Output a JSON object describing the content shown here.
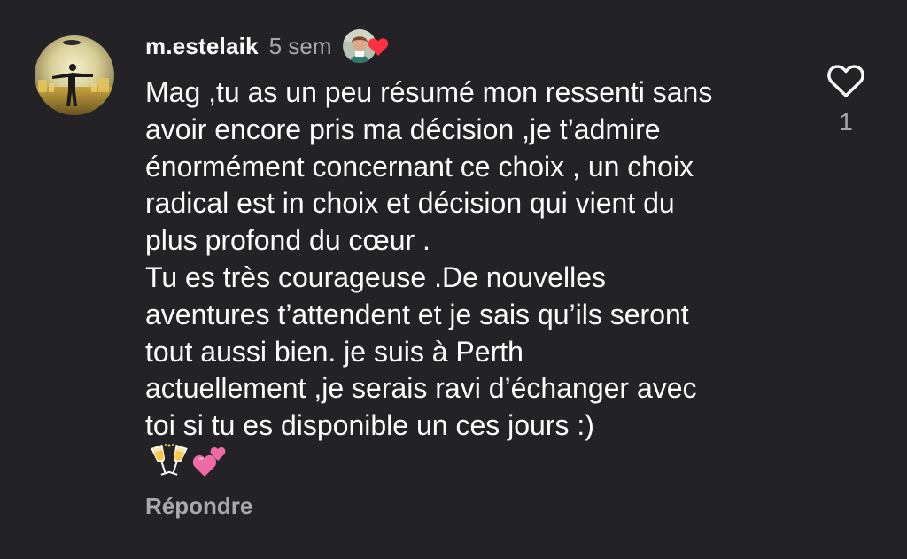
{
  "comment": {
    "username": "m.estelaik",
    "timestamp": "5 sem",
    "liked_by_author": {
      "avatar_icon": "author-avatar-icon",
      "heart_icon": "heart-filled-icon",
      "heart_color": "#ff3040"
    },
    "text": "Mag ,tu as un peu résumé mon ressenti sans\navoir encore pris ma décision ,je t’admire\nénormément concernant ce choix , un choix\nradical est in choix et décision qui vient du\nplus profond du cœur .\nTu es très courageuse .De nouvelles\naventures t’attendent et je sais qu’ils seront\ntout aussi bien. je suis à Perth\nactuellement ,je serais ravi d’échanger avec\ntoi si tu es disponible un ces jours :)",
    "emojis": [
      "🥂",
      "💕"
    ],
    "reply_label": "Répondre",
    "like_count": "1",
    "like_icon": "heart-outline-icon"
  },
  "colors": {
    "background": "#232327",
    "text_primary": "#ffffff",
    "text_secondary": "#a8a8ad",
    "heart_red": "#ff3040"
  }
}
